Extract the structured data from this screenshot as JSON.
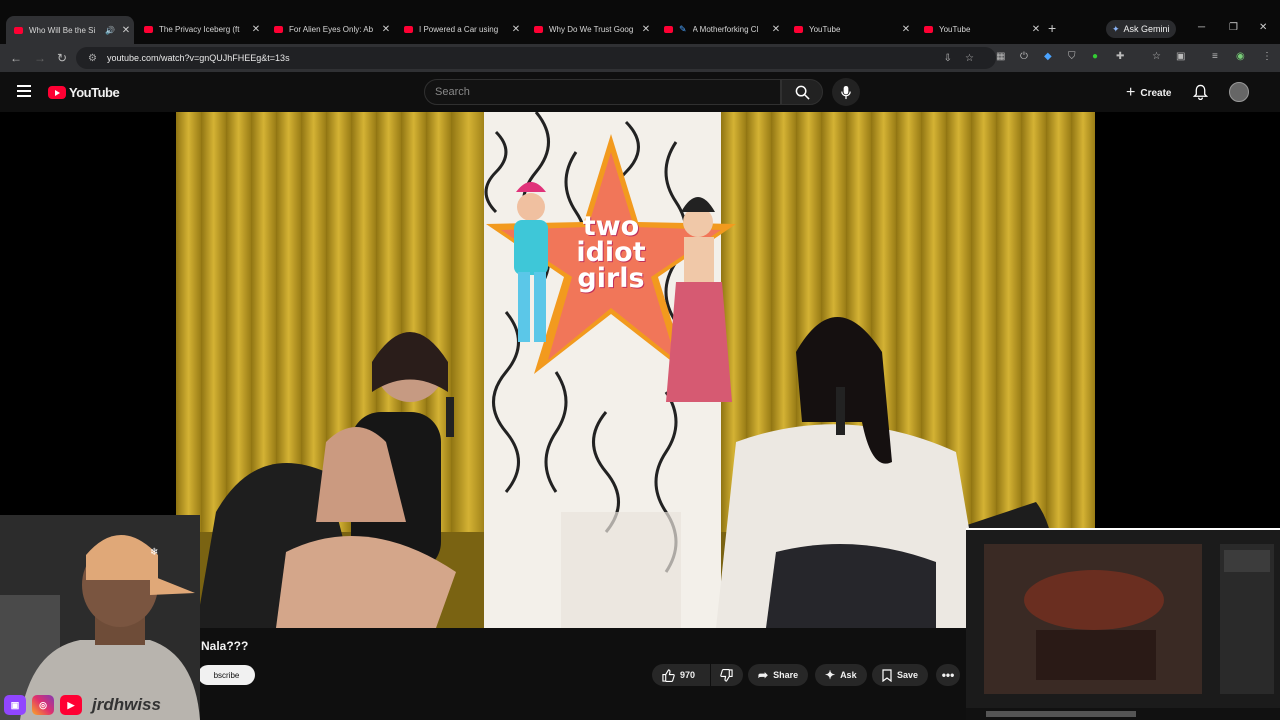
{
  "browser": {
    "tabs": [
      {
        "title": "Who Will Be the Si",
        "active": true,
        "audio": true,
        "icon": "youtube-favicon"
      },
      {
        "title": "The Privacy Iceberg (ft",
        "active": false,
        "icon": "youtube-favicon"
      },
      {
        "title": "For Alien Eyes Only: Ab",
        "active": false,
        "icon": "youtube-favicon"
      },
      {
        "title": "I Powered a Car using ",
        "active": false,
        "icon": "youtube-favicon"
      },
      {
        "title": "Why Do We Trust Goog",
        "active": false,
        "icon": "youtube-favicon"
      },
      {
        "title": "A Motherforking Cl",
        "active": false,
        "icon": "youtube-favicon"
      },
      {
        "title": "YouTube",
        "active": false,
        "icon": "youtube-favicon"
      },
      {
        "title": "YouTube",
        "active": false,
        "icon": "youtube-favicon"
      }
    ],
    "new_tab_symbol": "+",
    "ask_gemini_label": "Ask Gemini",
    "url": "youtube.com/watch?v=gnQUJhFHEEg&t=13s"
  },
  "youtube": {
    "logo_text": "YouTube",
    "search_placeholder": "Search",
    "create_label": "Create",
    "video_title_partial": "y Nala???",
    "subscribe_label": "bscribe",
    "like_count": "970",
    "share_label": "Share",
    "ask_label": "Ask",
    "save_label": "Save"
  },
  "video_frame": {
    "sign_text_lines": [
      "two",
      "idiot",
      "girls"
    ]
  },
  "overlay": {
    "streamer_handle": "jrdhwiss",
    "social_icons": [
      "twitch-icon",
      "instagram-icon",
      "youtube-icon"
    ]
  },
  "colors": {
    "youtube_red": "#ff0033",
    "curtain_yellow": "#c9a52a",
    "page_bg": "#0f0f0f"
  }
}
